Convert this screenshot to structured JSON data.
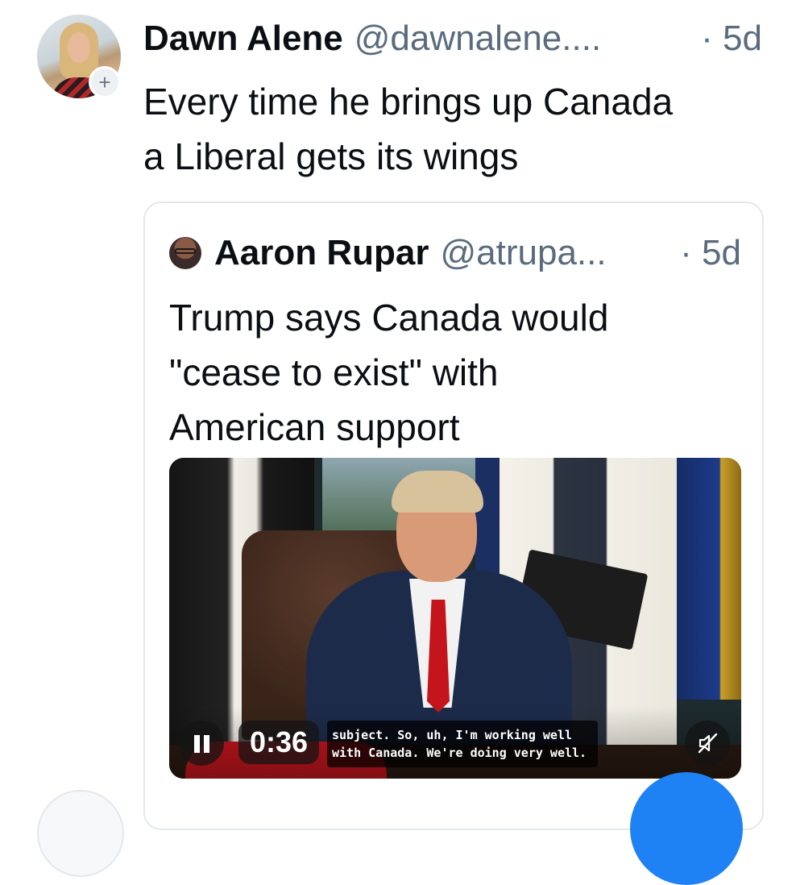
{
  "post": {
    "author_name": "Dawn Alene",
    "author_handle": "@dawnalene....",
    "time": "· 5d",
    "follow_symbol": "+",
    "text_line1": "Every time he brings up Canada",
    "text_line2": "a Liberal gets its wings"
  },
  "quote": {
    "author_name": "Aaron Rupar",
    "author_handle": "@atrupa...",
    "time": "· 5d",
    "text_line1": "Trump says Canada would",
    "text_line2": "\"cease to exist\" with",
    "text_line3": "American support"
  },
  "video": {
    "elapsed": "0:36",
    "caption_line1": "subject. So, uh, I'm working well",
    "caption_line2": "with Canada. We're doing very well.",
    "play_state_icon": "pause-icon",
    "audio_state_icon": "muted-speaker-icon"
  },
  "colors": {
    "text_primary": "#0b0f14",
    "text_secondary": "#5a6b7d",
    "border": "#e4e8ec",
    "fab": "#1e82f5"
  }
}
